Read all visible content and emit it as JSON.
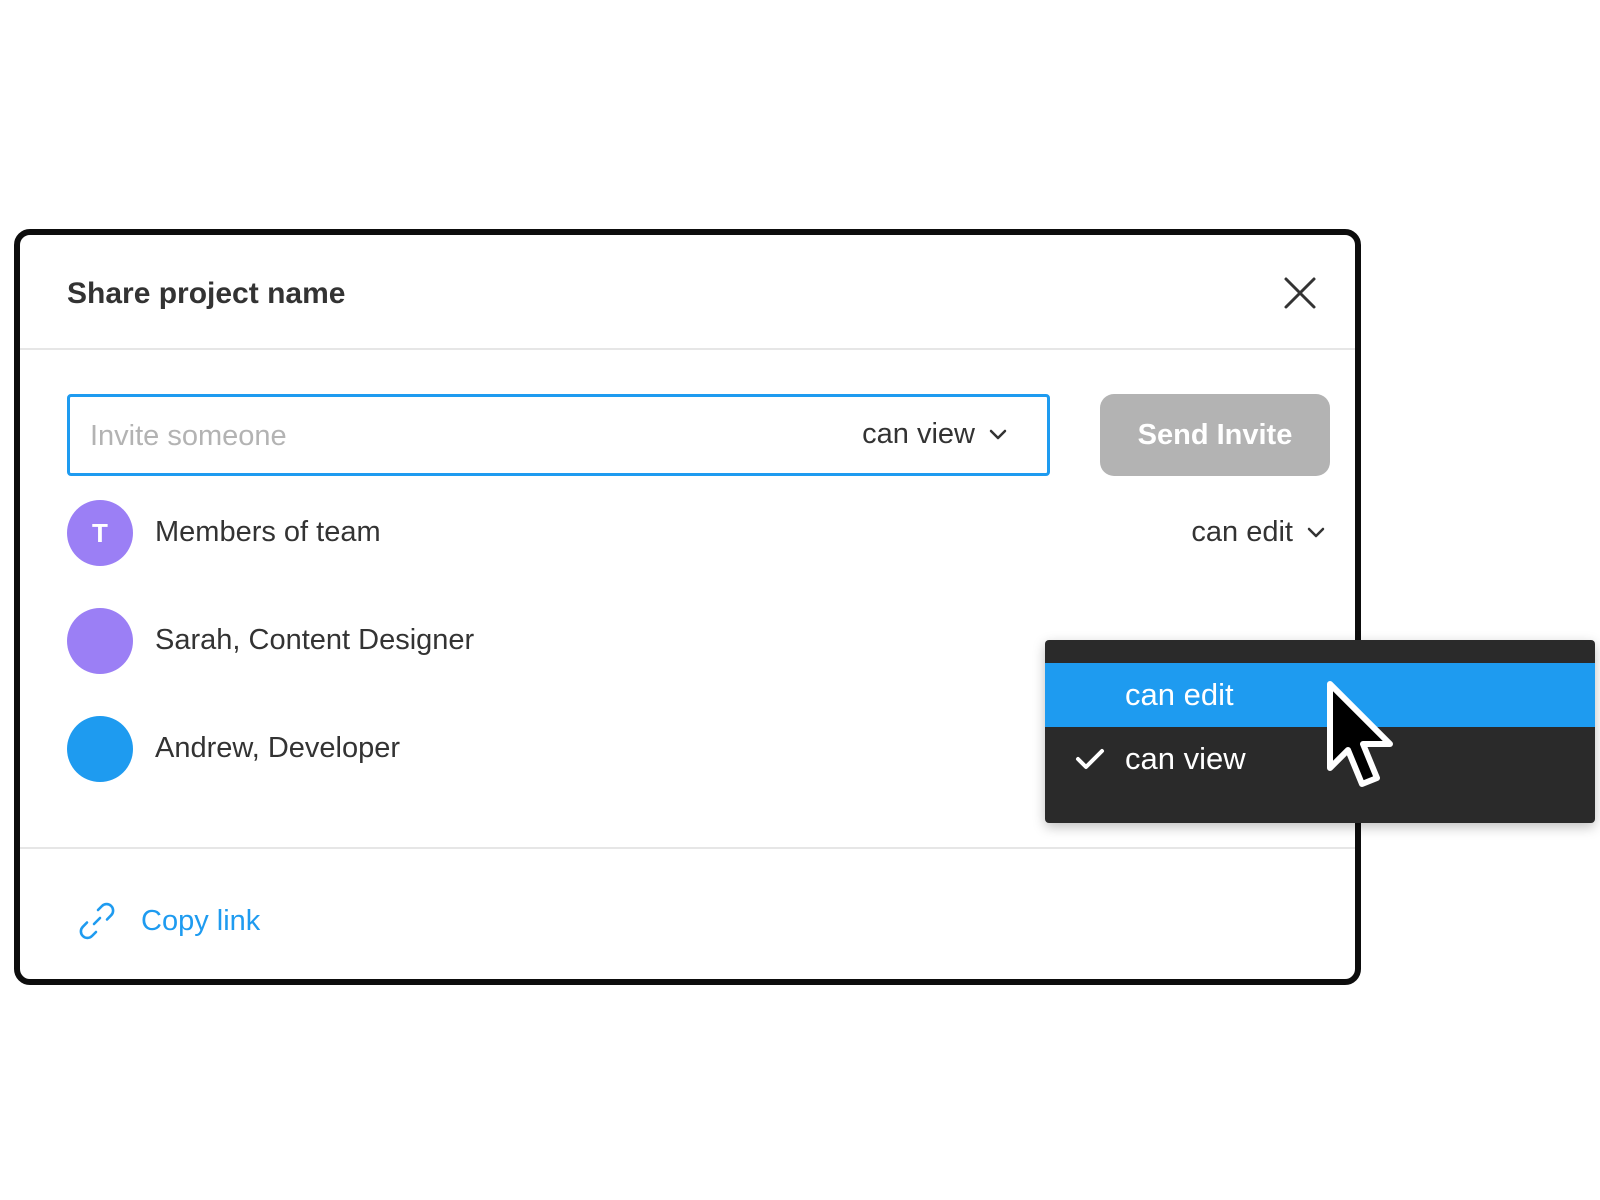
{
  "dialog": {
    "title": "Share project name"
  },
  "invite": {
    "placeholder": "Invite someone",
    "role": "can view",
    "send_label": "Send Invite"
  },
  "members": [
    {
      "initial": "T",
      "name": "Members of team",
      "role": "can edit",
      "avatar_color": "#9b7ff5"
    },
    {
      "initial": "",
      "name": "Sarah, Content Designer",
      "avatar_color": "#9b7ff5"
    },
    {
      "initial": "",
      "name": "Andrew, Developer",
      "avatar_color": "#1e9bf0"
    }
  ],
  "dropdown": {
    "options": [
      {
        "label": "can edit",
        "highlighted": true,
        "checked": false
      },
      {
        "label": "can view",
        "highlighted": false,
        "checked": true
      }
    ]
  },
  "footer": {
    "copy_link_label": "Copy link"
  },
  "colors": {
    "accent": "#1e9bf0",
    "purple": "#9b7ff5",
    "button_disabled": "#b3b3b3",
    "dropdown_bg": "#2a2a2a",
    "text": "#333333"
  },
  "icons": [
    "close-icon",
    "chevron-down-icon",
    "link-icon",
    "check-icon",
    "cursor-pointer-icon"
  ]
}
